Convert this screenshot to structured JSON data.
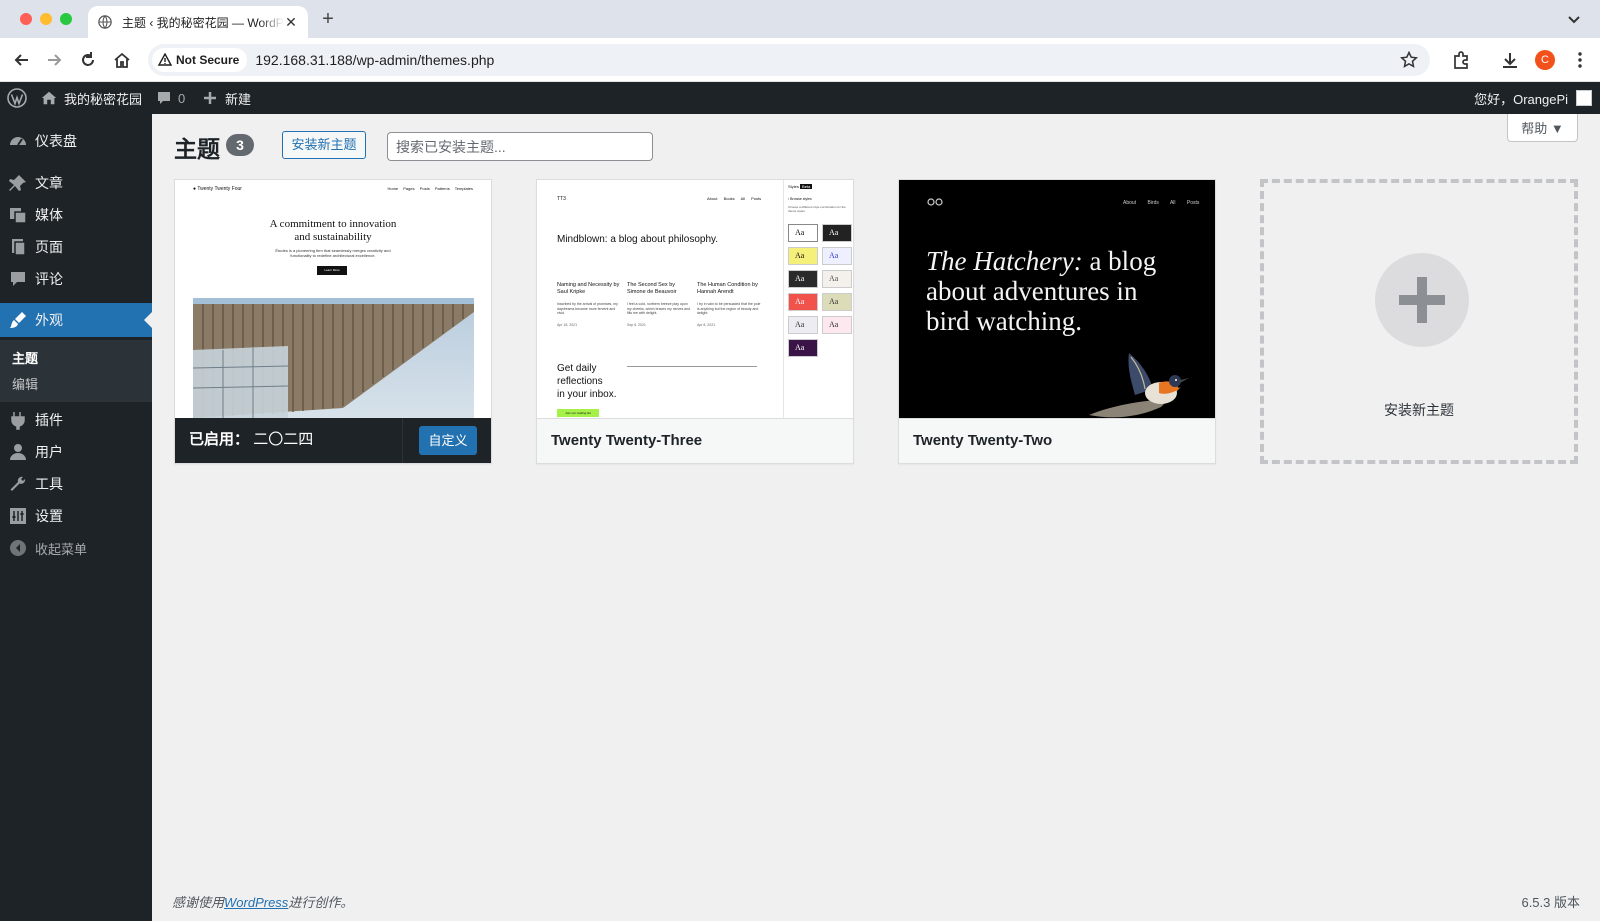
{
  "browser": {
    "tab_title": "主题 ‹ 我的秘密花园 — WordPress",
    "security_label": "Not Secure",
    "url": "192.168.31.188/wp-admin/themes.php",
    "profile_initial": "C"
  },
  "adminbar": {
    "site_name": "我的秘密花园",
    "comments_count": "0",
    "new_label": "新建",
    "greeting": "您好，OrangePi"
  },
  "sidebar": {
    "items": [
      {
        "label": "仪表盘",
        "icon": "dashboard-icon"
      },
      {
        "label": "文章",
        "icon": "pushpin-icon"
      },
      {
        "label": "媒体",
        "icon": "media-icon"
      },
      {
        "label": "页面",
        "icon": "page-icon"
      },
      {
        "label": "评论",
        "icon": "comment-icon"
      },
      {
        "label": "外观",
        "icon": "brush-icon",
        "active": true
      },
      {
        "label": "插件",
        "icon": "plugin-icon"
      },
      {
        "label": "用户",
        "icon": "user-icon"
      },
      {
        "label": "工具",
        "icon": "wrench-icon"
      },
      {
        "label": "设置",
        "icon": "settings-icon"
      }
    ],
    "submenu": [
      "主题",
      "编辑"
    ],
    "collapse_label": "收起菜单"
  },
  "main": {
    "help_label": "帮助 ▼",
    "title": "主题",
    "count": "3",
    "add_button": "安装新主题",
    "search_placeholder": "搜索已安装主题...",
    "themes": [
      {
        "name": "二〇二四",
        "active_prefix": "已启用：",
        "customize_label": "自定义",
        "preview": {
          "site": "Twenty Twenty Four",
          "nav": "Home Pages Posts Patterns Templates",
          "headline_1": "A commitment to innovation",
          "headline_2": "and sustainability",
          "body": "Études is a pioneering firm that seamlessly merges creativity and functionality to redefine architectural excellence.",
          "button": "Learn More"
        }
      },
      {
        "name": "Twenty Twenty-Three",
        "preview": {
          "logo": "TT3",
          "nav": "About Books All Posts",
          "headline": "Mindblown: a blog about philosophy.",
          "posts": [
            {
              "title": "Naming and Necessity by Saul Kripke",
              "excerpt": "Inscribed by the arrival of promises, my daydreams became more fervent and vivid.",
              "date": "Apr 18, 2021"
            },
            {
              "title": "The Second Sex by Simone de Beauvoir",
              "excerpt": "I feel a cold, northern breeze play upon my cheeks, which braces my nerves and fills me with delight.",
              "date": "Sep 6, 2021"
            },
            {
              "title": "The Human Condition by Hannah Arendt",
              "excerpt": "I try in vain to be persuaded that the pole is anything but the region of beauty and delight.",
              "date": "Apr 8, 2021"
            }
          ],
          "newsletter": [
            "Get daily",
            "reflections",
            "in your inbox."
          ],
          "newsletter_button": "Join our mailing list",
          "panel_title": "Styles",
          "panel_badge": "Beta",
          "panel_heading": "Browse styles",
          "panel_desc": "Choose a different style combination for the theme styles",
          "swatch_label": "Aa"
        }
      },
      {
        "name": "Twenty Twenty-Two",
        "preview": {
          "nav": "About Birds All Posts",
          "headline_em": "The Hatchery:",
          "headline_rest": " a blog about adventures in bird watching."
        }
      }
    ],
    "add_theme_label": "安装新主题"
  },
  "footer": {
    "thanks_prefix": "感谢使用",
    "thanks_link": "WordPress",
    "thanks_suffix": "进行创作。",
    "version": "6.5.3 版本"
  }
}
